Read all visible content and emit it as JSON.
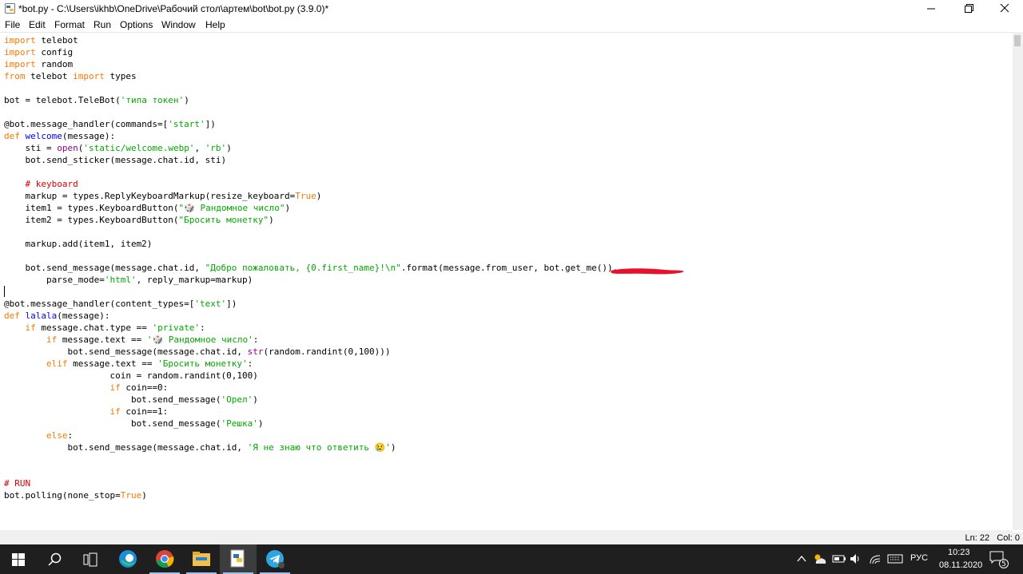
{
  "window": {
    "title": "*bot.py - C:\\Users\\ikhb\\OneDrive\\Рабочий стол\\артем\\bot\\bot.py (3.9.0)*",
    "icon": "python-idle-icon",
    "controls": [
      "minimize-icon",
      "maximize-icon",
      "close-icon"
    ]
  },
  "menubar": {
    "items": [
      "File",
      "Edit",
      "Format",
      "Run",
      "Options",
      "Window",
      "Help"
    ]
  },
  "code_lines": [
    "import telebot",
    "import config",
    "import random",
    "from telebot import types",
    "",
    "bot = telebot.TeleBot('типа токен')",
    "",
    "@bot.message_handler(commands=['start'])",
    "def welcome(message):",
    "    sti = open('static/welcome.webp', 'rb')",
    "    bot.send_sticker(message.chat.id, sti)",
    "",
    "    # keyboard",
    "    markup = types.ReplyKeyboardMarkup(resize_keyboard=True)",
    "    item1 = types.KeyboardButton(\"🎲 Рандомное число\")",
    "    item2 = types.KeyboardButton(\"Бросить монетку\")",
    "",
    "    markup.add(item1, item2)",
    "",
    "    bot.send_message(message.chat.id, \"Добро пожаловать, {0.first_name}!\\n\".format(message.from_user, bot.get_me()),",
    "        parse_mode='html', reply_markup=markup)",
    "",
    "@bot.message_handler(content_types=['text'])",
    "def lalala(message):",
    "    if message.chat.type == 'private':",
    "        if message.text == '🎲 Рандомное число':",
    "            bot.send_message(message.chat.id, str(random.randint(0,100)))",
    "        elif message.text == 'Бросить монетку':",
    "                    coin = random.randint(0,100)",
    "                    if coin==0:",
    "                        bot.send_message('Орел')",
    "                    if coin==1:",
    "                        bot.send_message('Решка')",
    "        else:",
    "            bot.send_message(message.chat.id, 'Я не знаю что ответить 😢')",
    "",
    "",
    "# RUN",
    "bot.polling(none_stop=True)"
  ],
  "status": {
    "ln_col": "Ln: 22   Col: 0"
  },
  "taskbar": {
    "apps": [
      "windows-start-icon",
      "search-icon",
      "task-view-icon",
      "edge-icon",
      "chrome-icon",
      "file-explorer-icon",
      "python-idle-icon",
      "telegram-icon"
    ],
    "language": "РУС",
    "time": "10:23",
    "date": "08.11.2020",
    "notification_count": "5"
  },
  "colors": {
    "keyword": "#ff7700",
    "string": "#00aa00",
    "builtin": "#900090",
    "definition": "#0000ff",
    "comment": "#dd0000",
    "redaction": "#e8102a",
    "taskbar": "#1f1f1f"
  }
}
